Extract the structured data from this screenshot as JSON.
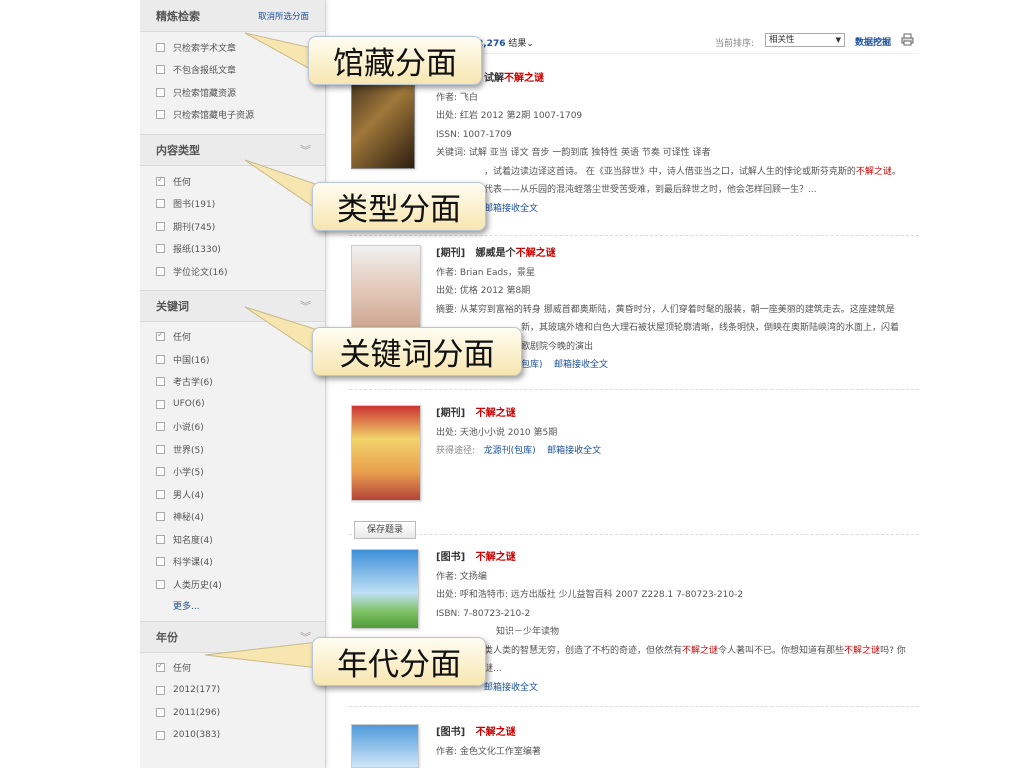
{
  "sidebar": {
    "refine": {
      "title": "精炼检索",
      "clear": "取消所选分面",
      "options": [
        "只检索学术文章",
        "不包含报纸文章",
        "只检索馆藏资源",
        "只检索馆藏电子资源"
      ]
    },
    "content_type": {
      "title": "内容类型",
      "options": [
        "任何",
        "图书(191)",
        "期刊(745)",
        "报纸(1330)",
        "学位论文(16)"
      ]
    },
    "keywords": {
      "title": "关键词",
      "options": [
        "任何",
        "中国(16)",
        "考古学(6)",
        "UFO(6)",
        "小说(6)",
        "世界(5)",
        "小学(5)",
        "男人(4)",
        "神秘(4)",
        "知名度(4)",
        "科学课(4)",
        "人类历史(4)"
      ],
      "more": "更多..."
    },
    "year": {
      "title": "年份",
      "options": [
        "任何",
        "2012(177)",
        "2011(296)",
        "2010(383)"
      ]
    }
  },
  "topbar": {
    "count": "2,276",
    "count_suffix": "结果",
    "sort_label": "当前排序:",
    "sort_value": "相关性",
    "data_mining": "数据挖掘"
  },
  "results": [
    {
      "title_suffix": "试解",
      "title_hl": "不解之谜",
      "lines": [
        "作者: 飞白",
        "出处: 红岩 2012 第2期 1007-1709",
        "ISSN: 1007-1709",
        "关键词: 试解 亚当 译文 音步 一韵到底 独特性 英语 节奏 可译性 译者",
        "",
        "代表——从乐园的混沌蛭落尘世受苦受难，到最后辞世之时，他会怎样回顾一生？...",
        ""
      ],
      "l5a": "，试着边读边译这首诗。 在《亚当辞世》中，诗人借亚当之口，试解人生的悖论或斯芬克斯的",
      "l5hl": "不解之谜",
      "l5b": "。",
      "link": "邮箱接收全文"
    },
    {
      "type": "[期刊]",
      "title_pre": "娜威是个",
      "title_hl": "不解之谜",
      "lines": [
        "作者: Brian Eads，景星",
        "出处: 优格 2012 第8期",
        "摘要: 从某穷到富裕的转身 挪威首都奥斯陆，黄昏时分，人们穿着时髦的服装，朝一座美丽的建筑走去。这座建筑是",
        "新，其玻璃外墙和白色大理石被状屋顶轮廓清晰，线条明快，倒映在奥斯陆峡湾的水面上，闪着",
        "歌剧院今晚的演出"
      ],
      "link_a": "包库)",
      "link_b": "邮箱接收全文"
    },
    {
      "type": "[期刊]",
      "title_hl": "不解之谜",
      "lines": [
        "出处: 天池小小说 2010 第5期"
      ],
      "get_label": "获得途径:",
      "link_a": "龙源刊(包库)",
      "link_b": "邮箱接收全文",
      "save": "保存题录"
    },
    {
      "type": "[图书]",
      "title_hl": "不解之谜",
      "lines": [
        "作者: 文扬编",
        "出处: 呼和浩特市: 远方出版社 少儿益智百科 2007 Z228.1 7-80723-210-2",
        "ISBN: 7-80723-210-2",
        "知识－少年读物",
        "谜...",
        ""
      ],
      "l5a": "类人类的智慧无穷，创造了不朽的奇迹，但依然有",
      "l5hl": "不解之谜",
      "l5b": "令人著叫不已。你想知道有那些",
      "l5hl2": "不解之谜",
      "l5c": "吗? 你",
      "link": "邮箱接收全文"
    },
    {
      "type": "[图书]",
      "title_hl": "不解之谜",
      "lines": [
        "作者: 金色文化工作室编著"
      ]
    }
  ],
  "callouts": {
    "holdings": "馆藏分面",
    "type": "类型分面",
    "keyword": "关键词分面",
    "year": "年代分面"
  },
  "colors": {
    "link": "#1a4f9c",
    "highlight": "#cc0000",
    "callout_fill": "#f7e6b0"
  }
}
